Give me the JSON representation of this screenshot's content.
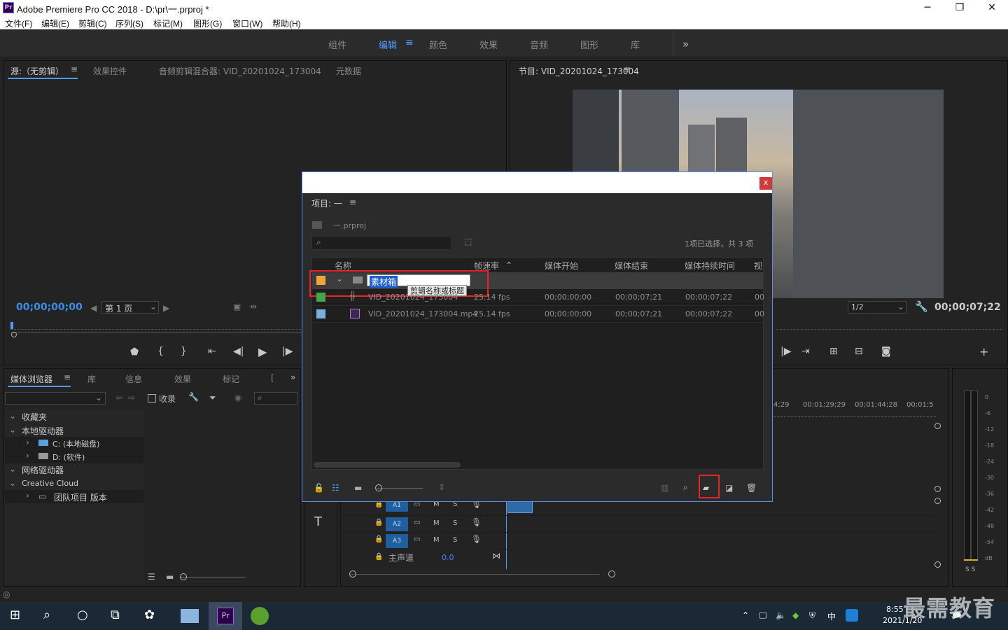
{
  "window": {
    "title": "Adobe Premiere Pro CC 2018 - D:\\pr\\一.prproj *",
    "app_icon": "Pr",
    "minimize": "─",
    "maximize": "❐",
    "close": "✕"
  },
  "menubar": [
    "文件(F)",
    "编辑(E)",
    "剪辑(C)",
    "序列(S)",
    "标记(M)",
    "图形(G)",
    "窗口(W)",
    "帮助(H)"
  ],
  "workspaces": {
    "items": [
      "组件",
      "编辑",
      "颜色",
      "效果",
      "音频",
      "图形",
      "库"
    ],
    "active": "编辑",
    "more": "»"
  },
  "source_panel": {
    "tabs": [
      "源:（无剪辑）",
      "效果控件",
      "音频剪辑混合器: VID_20201024_173004",
      "元数据"
    ],
    "timecode": "00;00;00;00",
    "page": "第 1 页"
  },
  "program_panel": {
    "title": "节目: VID_20201024_173004",
    "resolution": "1/2",
    "timecode": "00;00;07;22"
  },
  "media_browser": {
    "tabs": [
      "媒体浏览器",
      "库",
      "信息",
      "效果",
      "标记",
      "[",
      "»"
    ],
    "ingest": "收录",
    "tree": [
      {
        "label": "收藏夹",
        "level": 0
      },
      {
        "label": "本地驱动器",
        "level": 0
      },
      {
        "label": "C: (本地磁盘)",
        "level": 1
      },
      {
        "label": "D: (软件)",
        "level": 1
      },
      {
        "label": "网络驱动器",
        "level": 0
      },
      {
        "label": "Creative Cloud",
        "level": 0
      },
      {
        "label": "团队项目 版本",
        "level": 1
      }
    ]
  },
  "timeline": {
    "ruler": [
      "4;29",
      "00;01;29;29",
      "00;01;44;28",
      "00;01;5"
    ],
    "tracks": [
      {
        "name": "A1",
        "m": "M",
        "s": "S"
      },
      {
        "name": "A2",
        "m": "M",
        "s": "S"
      },
      {
        "name": "A3",
        "m": "M",
        "s": "S"
      }
    ],
    "master_label": "主声道",
    "master_value": "0.0"
  },
  "meter_scale": [
    "0",
    "-6",
    "-12",
    "-18",
    "-24",
    "-30",
    "-36",
    "-42",
    "-48",
    "-54",
    "dB"
  ],
  "meter_solo": "S S",
  "project_dialog": {
    "title": "项目: 一",
    "file": "一.prproj",
    "selection_info": "1项已选择，共 3 项",
    "columns": [
      "名称",
      "帧速率",
      "媒体开始",
      "媒体结束",
      "媒体持续时间",
      "视"
    ],
    "bin_name": "素材箱",
    "tooltip": "剪辑名称或标题",
    "rows": [
      {
        "name": "VID_20201024_173004",
        "fps": "25.14 fps",
        "start": "00;00;00;00",
        "end": "00;00;07;21",
        "dur": "00;00;07;22",
        "v": "00",
        "label_color": "#3fa84a"
      },
      {
        "name": "VID_20201024_173004.mp4",
        "fps": "25.14 fps",
        "start": "00;00;00;00",
        "end": "00;00;07;21",
        "dur": "00;00;07;22",
        "v": "00",
        "label_color": "#7bb0dd"
      }
    ],
    "bin_label_color": "#f0a53a",
    "close": "x"
  },
  "taskbar": {
    "time": "8:55",
    "date": "2021/1/20",
    "ime": "中",
    "watermark": "最需教育"
  }
}
